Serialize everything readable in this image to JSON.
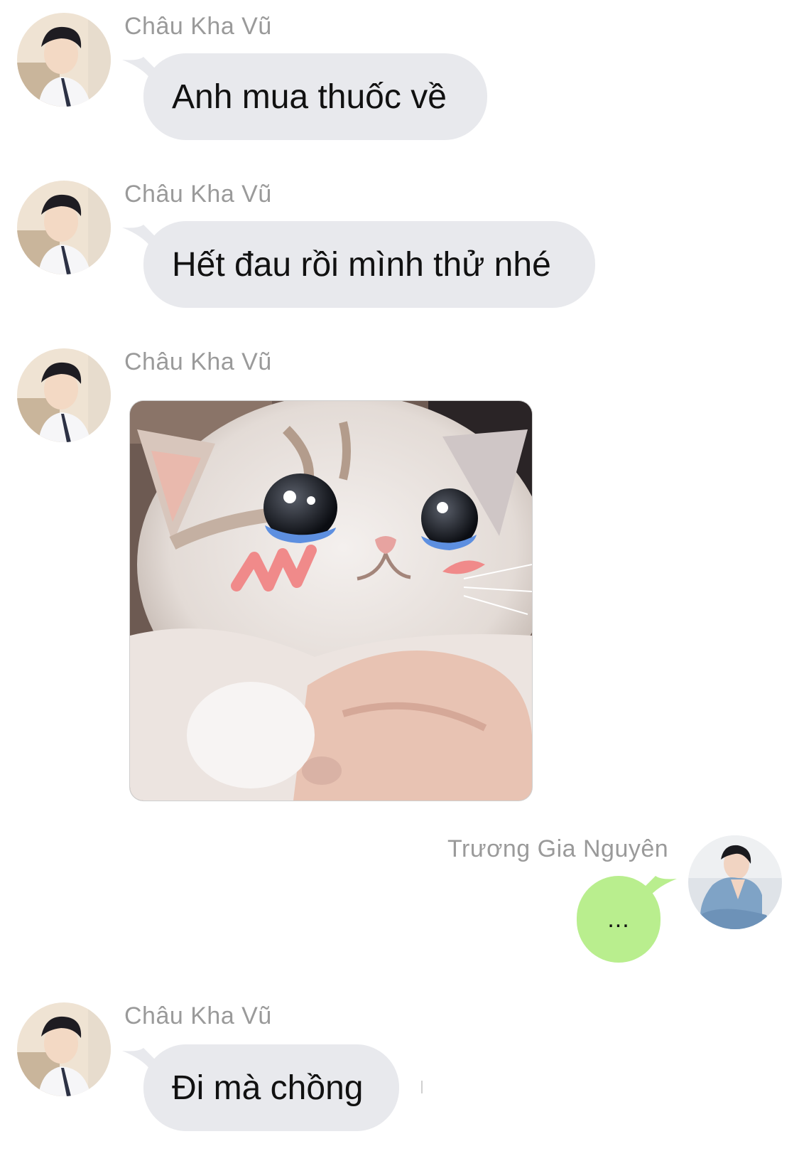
{
  "participants": {
    "other": {
      "name": "Châu Kha Vũ"
    },
    "self": {
      "name": "Trương Gia Nguyên"
    }
  },
  "messages": [
    {
      "sender": "Châu Kha Vũ",
      "type": "text",
      "text": "Anh mua thuốc về"
    },
    {
      "sender": "Châu Kha Vũ",
      "type": "text",
      "text": "Hết đau rồi mình thử nhé"
    },
    {
      "sender": "Châu Kha Vũ",
      "type": "image",
      "image": "crying-cat-sticker"
    },
    {
      "sender": "Trương Gia Nguyên",
      "type": "text",
      "text": "..."
    },
    {
      "sender": "Châu Kha Vũ",
      "type": "text",
      "text": "Đi mà chồng"
    }
  ],
  "colors": {
    "incoming_bubble": "#e8e9ed",
    "outgoing_bubble": "#b9ee8e",
    "sender_name": "#9a9a9a"
  }
}
